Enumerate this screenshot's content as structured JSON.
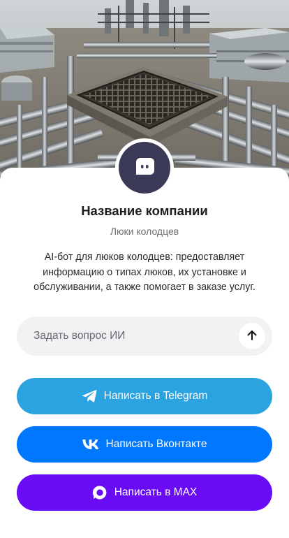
{
  "profile": {
    "company_name": "Название компании",
    "subtitle": "Люки колодцев",
    "description": "AI-бот для люков колодцев: предоставляет информацию о типах люков, их установке и обслуживании, а также помогает в заказе услуг.",
    "avatar_icon": "chat-bot-icon"
  },
  "ask": {
    "placeholder": "Задать вопрос ИИ",
    "value": "",
    "send_icon": "arrow-up-icon"
  },
  "buttons": {
    "telegram": {
      "label": "Написать в Telegram",
      "icon": "telegram-icon",
      "color": "#2aa3e0"
    },
    "vk": {
      "label": "Написать Вконтакте",
      "icon": "vk-icon",
      "color": "#0077ff"
    },
    "max": {
      "label": "Написать в MAX",
      "icon": "max-icon",
      "color": "#6a0bf5"
    }
  },
  "colors": {
    "avatar_bg": "#3a3a56",
    "input_bg": "#f2f2f4"
  }
}
